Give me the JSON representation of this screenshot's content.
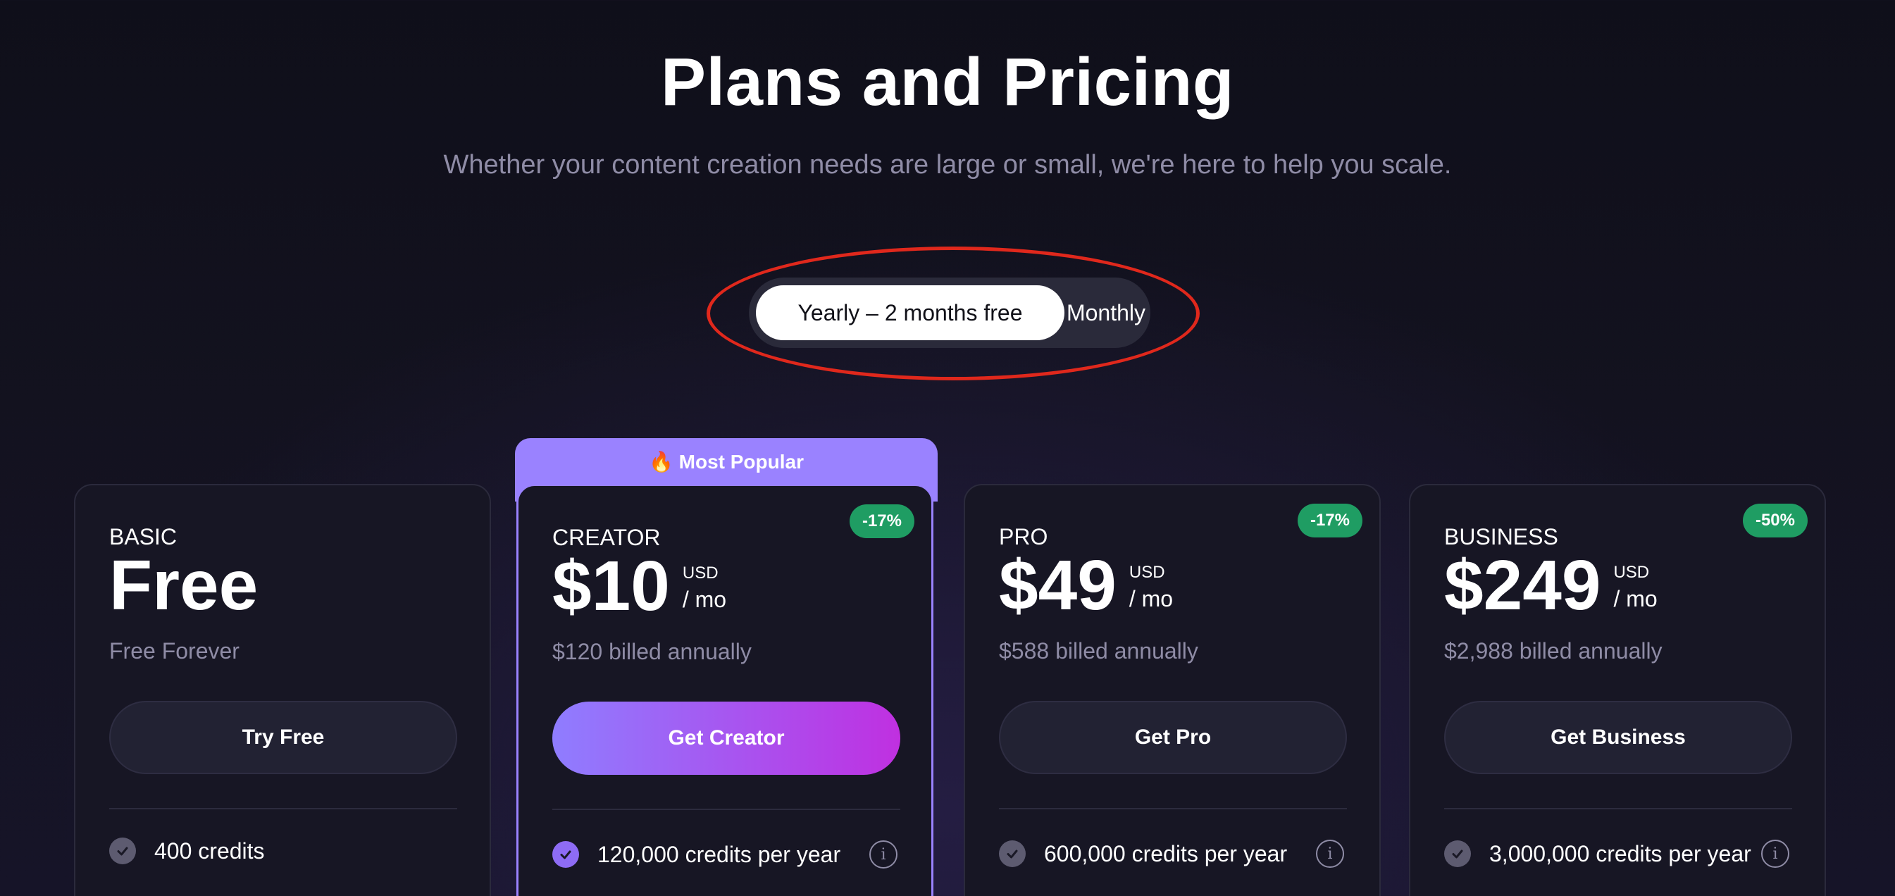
{
  "header": {
    "title": "Plans and Pricing",
    "subtitle": "Whether your content creation needs are large or small, we're here to help you scale."
  },
  "billing_toggle": {
    "options": [
      "Yearly – 2 months free",
      "Monthly"
    ],
    "selected": "Yearly – 2 months free"
  },
  "popular_badge": "🔥 Most Popular",
  "plans": [
    {
      "name": "BASIC",
      "price": "Free",
      "billed": "Free Forever",
      "cta": "Try Free",
      "feature": "400 credits"
    },
    {
      "name": "CREATOR",
      "discount": "-17%",
      "price": "$10",
      "currency": "USD",
      "period": "/ mo",
      "billed": "$120 billed annually",
      "cta": "Get Creator",
      "feature": "120,000 credits per year"
    },
    {
      "name": "PRO",
      "discount": "-17%",
      "price": "$49",
      "currency": "USD",
      "period": "/ mo",
      "billed": "$588 billed annually",
      "cta": "Get Pro",
      "feature": "600,000 credits per year"
    },
    {
      "name": "BUSINESS",
      "discount": "-50%",
      "price": "$249",
      "currency": "USD",
      "period": "/ mo",
      "billed": "$2,988 billed annually",
      "cta": "Get Business",
      "feature": "3,000,000 credits per year"
    }
  ],
  "icons": {
    "check": "check-circle-icon",
    "info": "info-icon"
  },
  "colors": {
    "accent": "#9a82ff",
    "cta_gradient_end": "#b73ce6",
    "discount_green": "#1f9d63",
    "annotation_red": "#e0281c"
  }
}
